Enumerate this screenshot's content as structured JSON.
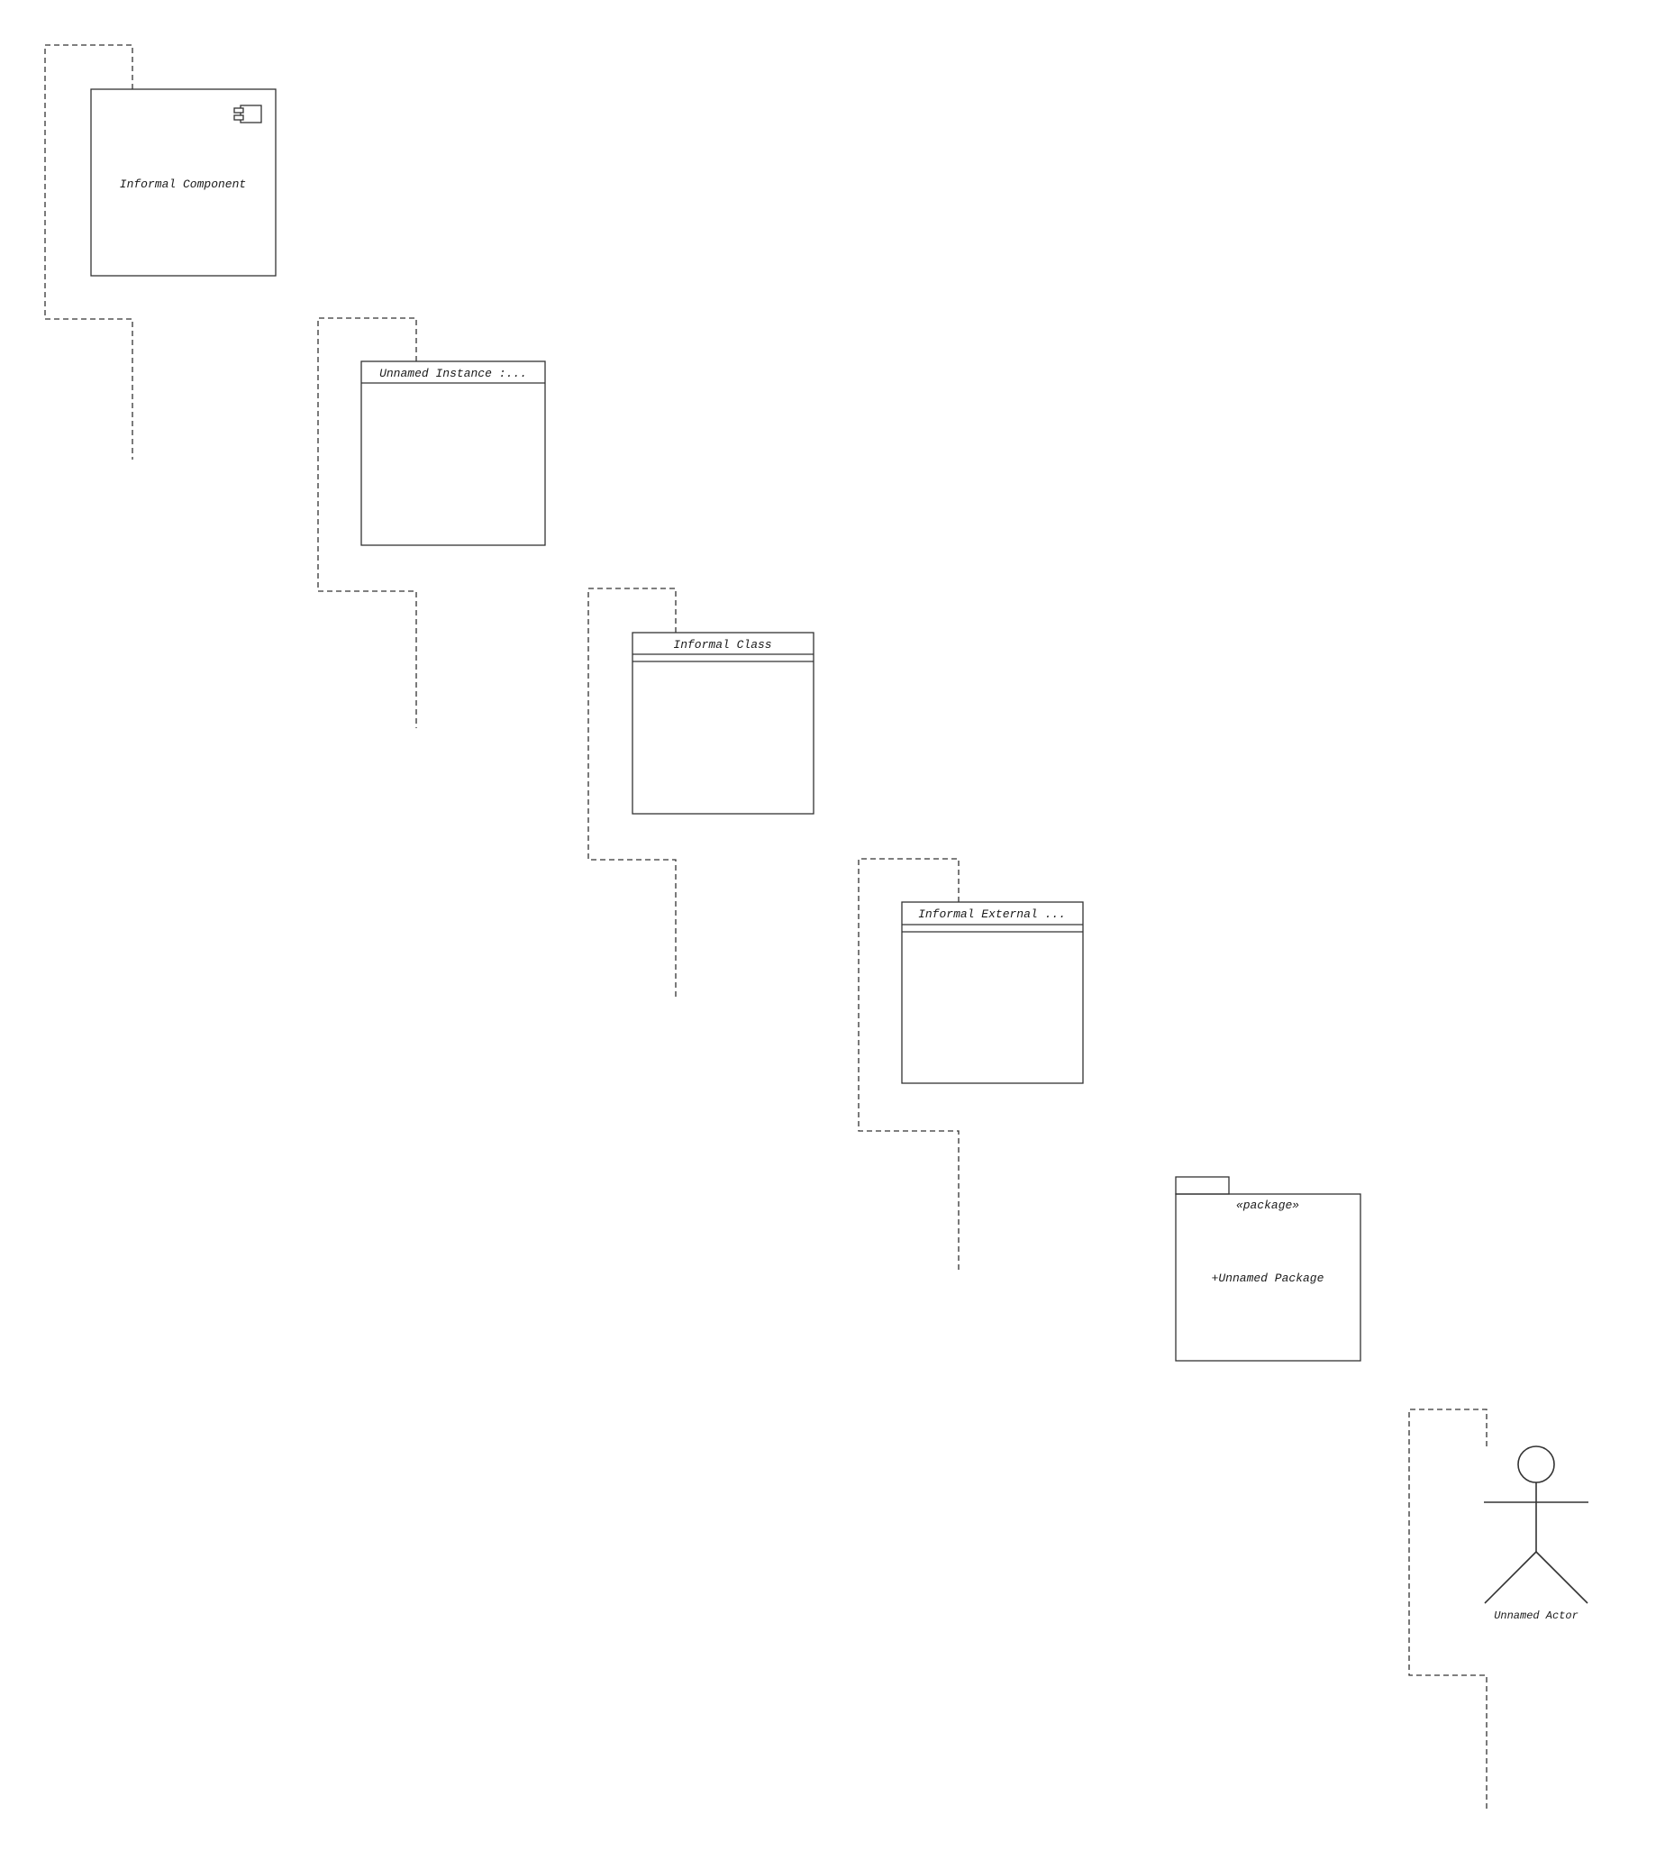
{
  "diagram": {
    "component": {
      "name": "Informal Component",
      "icon": "component-icon"
    },
    "instance": {
      "name": "Unnamed Instance :..."
    },
    "class": {
      "name": "Informal Class"
    },
    "external": {
      "name": "Informal External ..."
    },
    "package": {
      "stereotype": "«package»",
      "name": "+Unnamed Package"
    },
    "actor": {
      "name": "Unnamed Actor"
    }
  }
}
